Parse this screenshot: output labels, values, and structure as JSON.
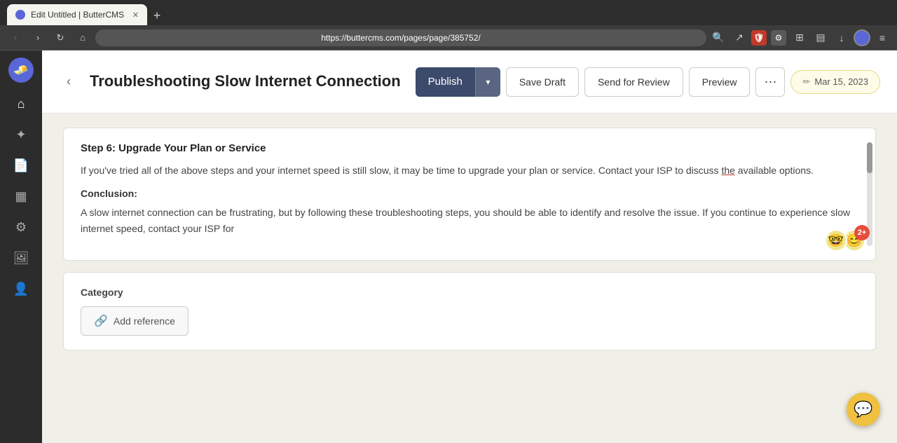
{
  "browser": {
    "tab_title": "Edit Untitled | ButterCMS",
    "url": "https://buttercms.com/pages/page/385752/",
    "new_tab_label": "+"
  },
  "header": {
    "back_label": "‹",
    "page_title": "Troubleshooting Slow Internet Connection",
    "publish_label": "Publish",
    "publish_dropdown_icon": "▾",
    "save_draft_label": "Save Draft",
    "send_review_label": "Send for Review",
    "preview_label": "Preview",
    "more_label": "···",
    "date_icon": "✏",
    "date_label": "Mar 15, 2023"
  },
  "content": {
    "step_heading": "Step 6: Upgrade Your Plan or Service",
    "paragraph1": "If you've tried all of the above steps and your internet speed is still slow, it may be time to upgrade your plan or service. Contact your ISP to discuss ",
    "underlined_word": "the",
    "paragraph1_end": " available options.",
    "conclusion_heading": "Conclusion:",
    "paragraph2": "A slow internet connection can be frustrating, but by following these troubleshooting steps, you should be able to identify and resolve the issue. If you continue to experience slow internet speed, contact your ISP for"
  },
  "category": {
    "label": "Category",
    "add_reference_label": "Add reference",
    "add_reference_icon": "🔗"
  },
  "sidebar": {
    "items": [
      {
        "name": "home",
        "icon": "⌂"
      },
      {
        "name": "blog",
        "icon": "✦"
      },
      {
        "name": "pages",
        "icon": "📄"
      },
      {
        "name": "media",
        "icon": "▦"
      },
      {
        "name": "integrations",
        "icon": "⚙"
      },
      {
        "name": "images",
        "icon": "🖼"
      },
      {
        "name": "users",
        "icon": "👤"
      }
    ]
  },
  "chat_widget": {
    "icon": "💬"
  }
}
